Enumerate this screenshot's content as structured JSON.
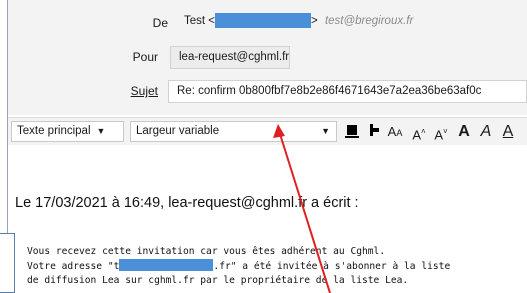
{
  "header": {
    "from_label": "De",
    "from_name": "Test <",
    "from_suffix": ">",
    "from_alias": "test@bregiroux.fr",
    "to_label": "Pour",
    "to_value": "lea-request@cghml.fr",
    "subject_label": "Sujet",
    "subject_value": "Re: confirm 0b800fbf7e8b2e86f4671643e7a2ea36be63af0c"
  },
  "toolbar": {
    "paragraph_format": "Texte principal",
    "font": "Largeur variable",
    "buttons": [
      "A",
      "A",
      "A",
      "A",
      "A",
      "A"
    ]
  },
  "message": {
    "quote_header": "Le 17/03/2021 à 16:49, lea-request@cghml.fr a écrit :",
    "line1": "Vous recevez cette invitation car vous êtes adhérent au Cghml.",
    "line2_start": "Votre adresse \"t",
    "line2_end": ".fr\" a été invitée à s'abonner à la liste",
    "line3": "de diffusion Lea sur cghml.fr par le propriétaire de la liste Lea."
  },
  "colors": {
    "redaction": "#4a8fd8",
    "annotation_arrow": "#e02020"
  }
}
